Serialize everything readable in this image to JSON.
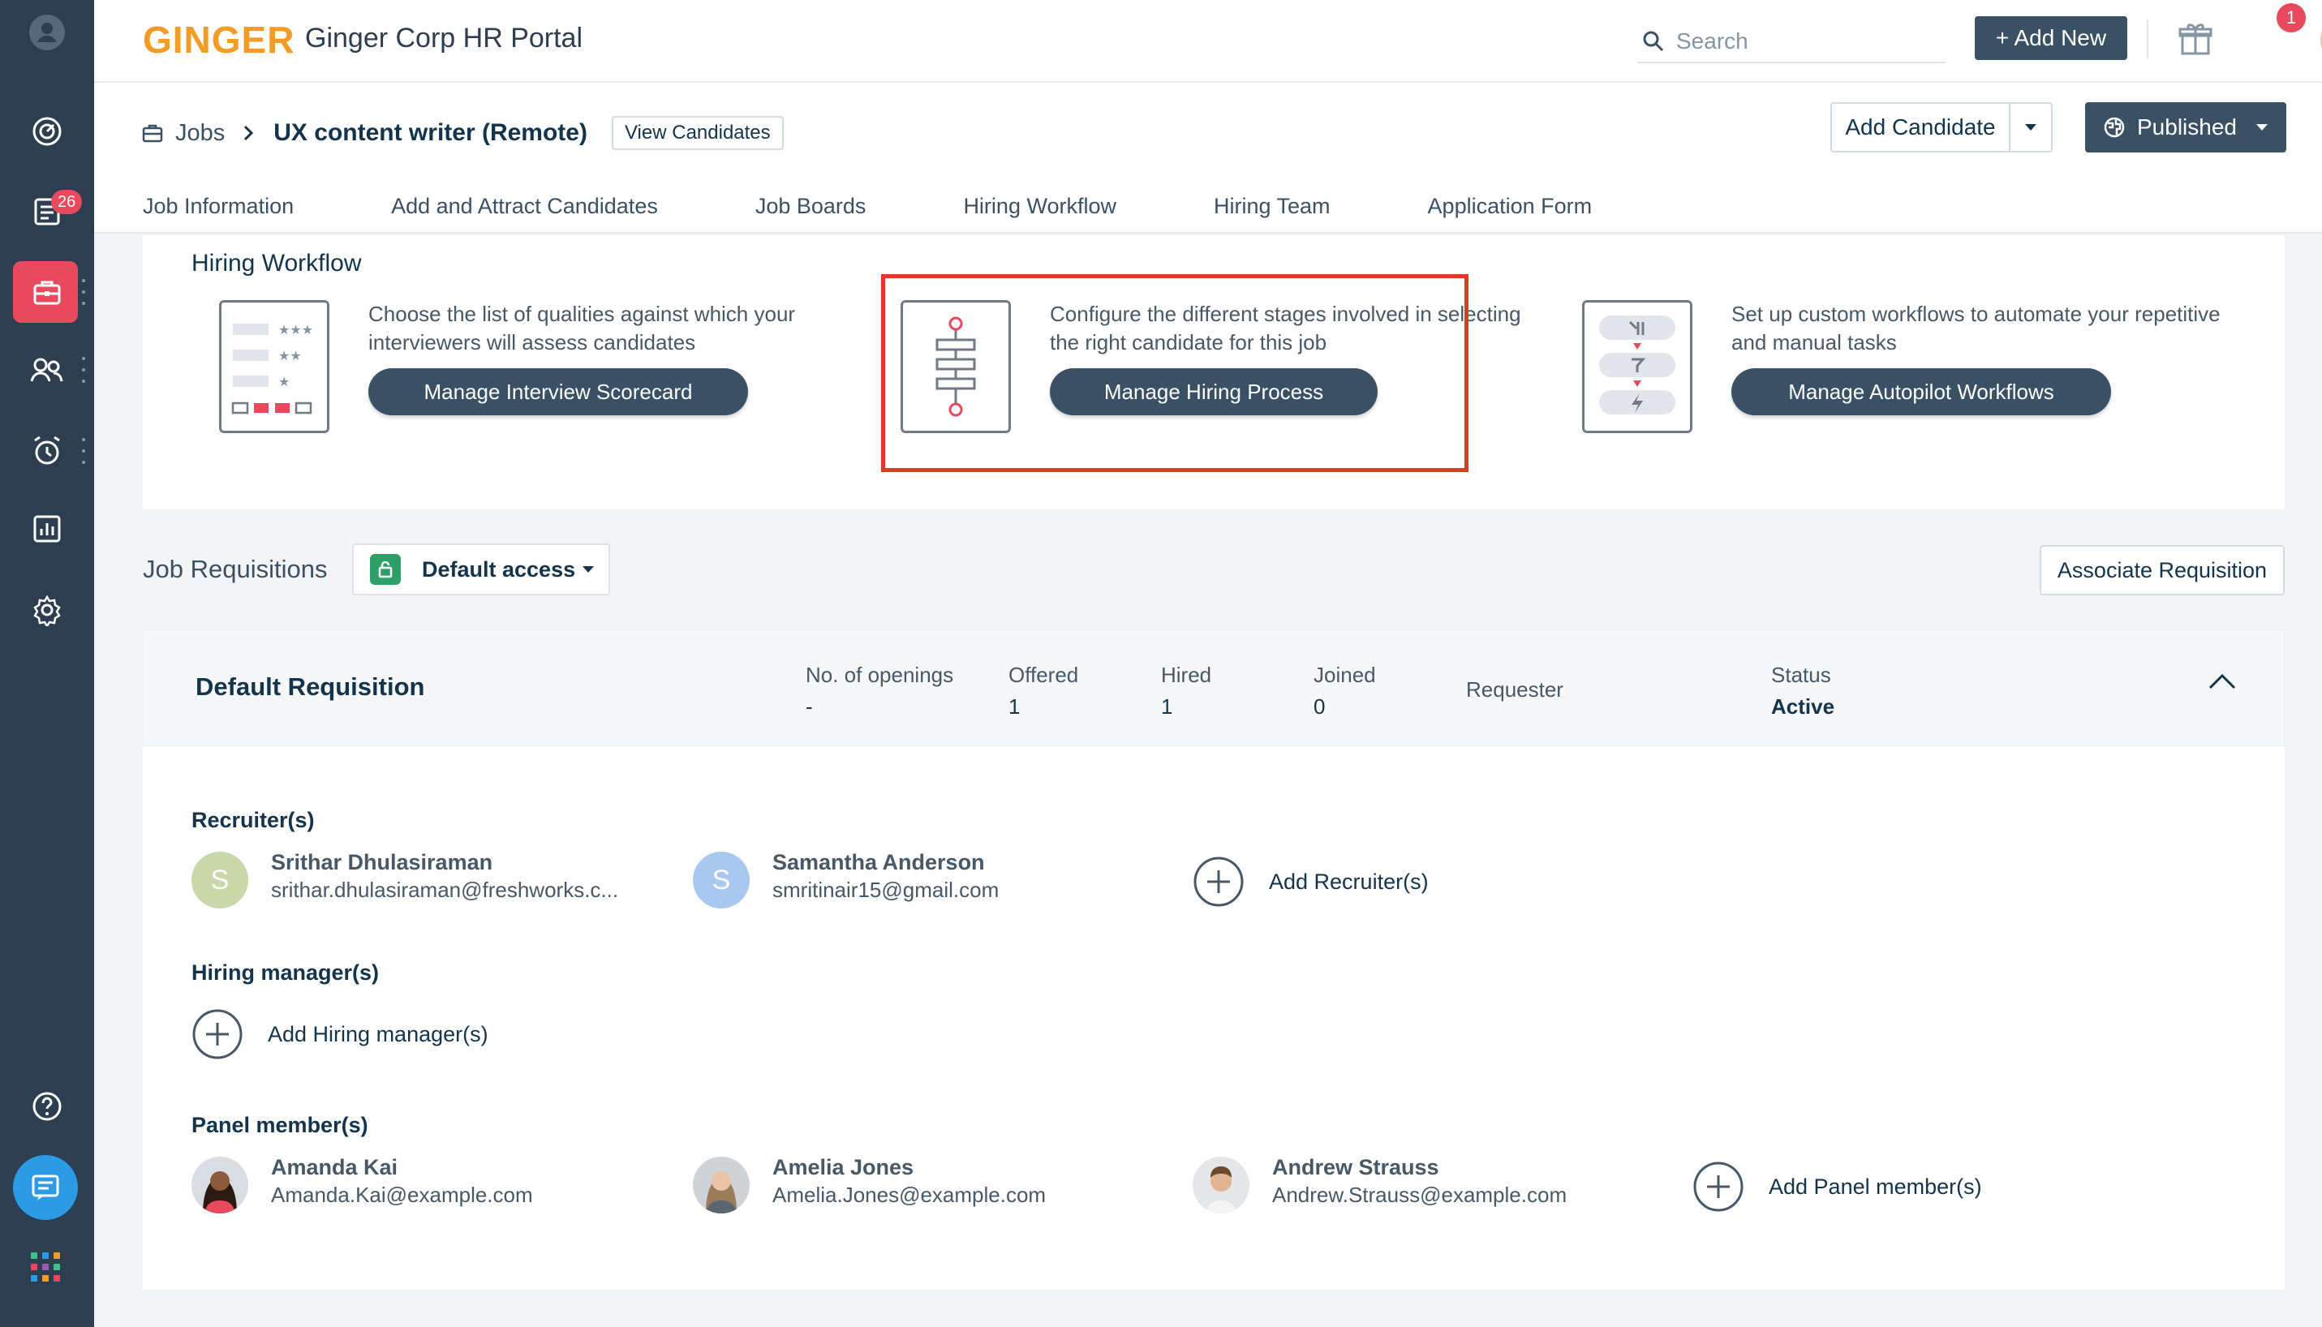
{
  "app": {
    "logo_text": "GINGER",
    "portal_title": "Ginger Corp HR Portal"
  },
  "sidebar": {
    "notification_count": "26"
  },
  "header": {
    "search_placeholder": "Search",
    "add_new_label": "+ Add New",
    "gift_badge_count": "1"
  },
  "breadcrumb": {
    "jobs_label": "Jobs",
    "job_title": "UX content writer (Remote)",
    "view_candidates_label": "View Candidates"
  },
  "actions": {
    "add_candidate_label": "Add Candidate",
    "published_label": "Published"
  },
  "tabs": [
    {
      "label": "Job Information"
    },
    {
      "label": "Add and Attract Candidates"
    },
    {
      "label": "Job Boards"
    },
    {
      "label": "Hiring Workflow"
    },
    {
      "label": "Hiring Team"
    },
    {
      "label": "Application Form"
    }
  ],
  "workflow": {
    "title": "Hiring Workflow",
    "items": [
      {
        "description": "Choose the list of qualities against which your interviewers will assess candidates",
        "button_label": "Manage Interview Scorecard"
      },
      {
        "description": "Configure the different stages involved in selecting the right candidate for this job",
        "button_label": "Manage Hiring Process"
      },
      {
        "description": "Set up custom workflows to automate your repetitive and manual tasks",
        "button_label": "Manage Autopilot Workflows"
      }
    ]
  },
  "requisitions": {
    "label": "Job Requisitions",
    "access_label": "Default access",
    "associate_label": "Associate Requisition",
    "default": {
      "name": "Default Requisition",
      "stats": [
        {
          "key": "No. of openings",
          "value": "-"
        },
        {
          "key": "Offered",
          "value": "1"
        },
        {
          "key": "Hired",
          "value": "1"
        },
        {
          "key": "Joined",
          "value": "0"
        },
        {
          "key": "Requester",
          "value": ""
        },
        {
          "key": "Status",
          "value": "Active"
        }
      ]
    }
  },
  "team": {
    "recruiters_title": "Recruiter(s)",
    "recruiters": [
      {
        "initial": "S",
        "name": "Srithar Dhulasiraman",
        "email": "srithar.dhulasiraman@freshworks.c...",
        "color": "#c8d8a8"
      },
      {
        "initial": "S",
        "name": "Samantha Anderson",
        "email": "smritinair15@gmail.com",
        "color": "#a9c8f0"
      }
    ],
    "add_recruiter_label": "Add Recruiter(s)",
    "hiring_managers_title": "Hiring manager(s)",
    "add_hiring_manager_label": "Add Hiring manager(s)",
    "panel_title": "Panel member(s)",
    "panel": [
      {
        "name": "Amanda Kai",
        "email": "Amanda.Kai@example.com"
      },
      {
        "name": "Amelia Jones",
        "email": "Amelia.Jones@example.com"
      },
      {
        "name": "Andrew Strauss",
        "email": "Andrew.Strauss@example.com"
      }
    ],
    "add_panel_label": "Add Panel member(s)"
  },
  "colors": {
    "sidebar_bg": "#2c3e50",
    "accent_red": "#e8495c",
    "primary_button": "#3a5165",
    "logo_orange": "#f29c25",
    "highlight_border": "#e03a26"
  }
}
